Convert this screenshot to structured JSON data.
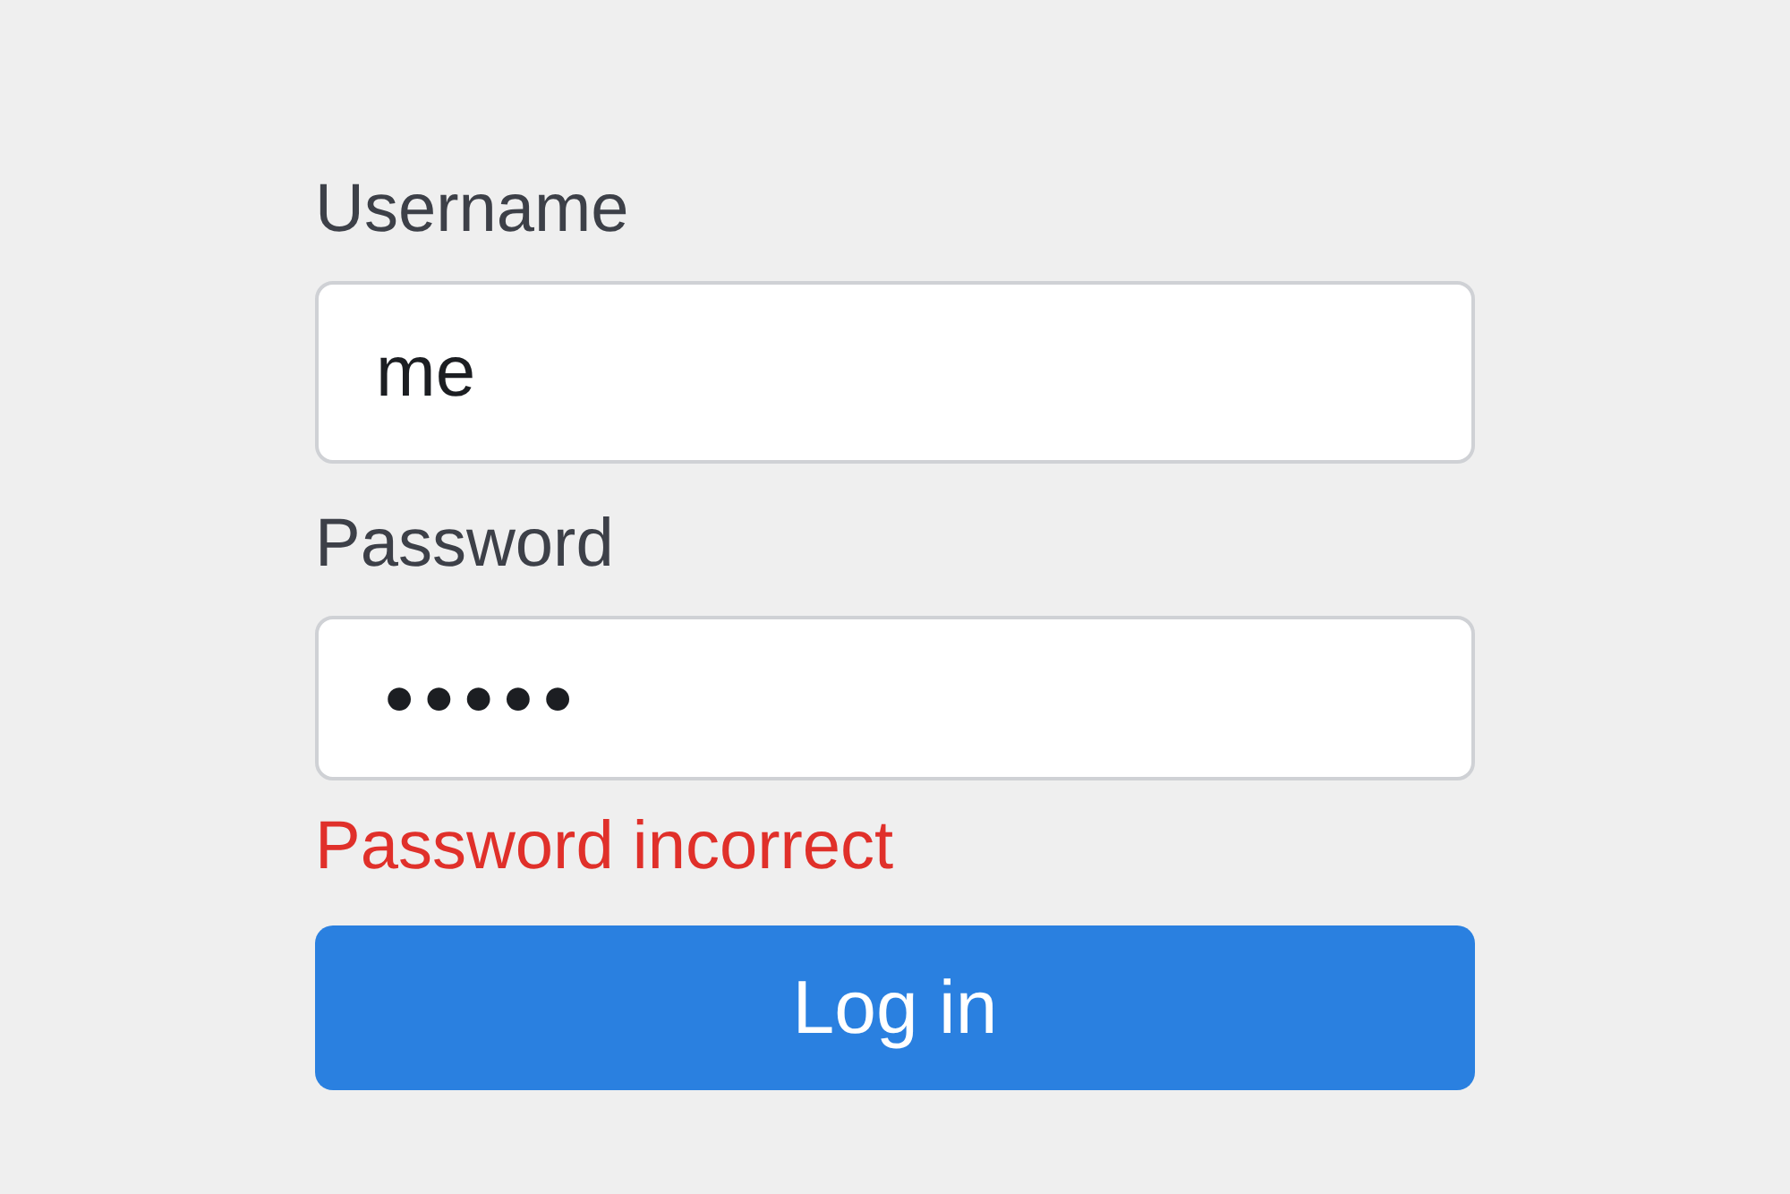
{
  "fields": [
    {
      "label": "Username",
      "value": "me",
      "kind": "text"
    },
    {
      "label": "Password",
      "value": "●●●●●",
      "kind": "masked"
    }
  ],
  "error": "Password incorrect",
  "button": "Log in"
}
